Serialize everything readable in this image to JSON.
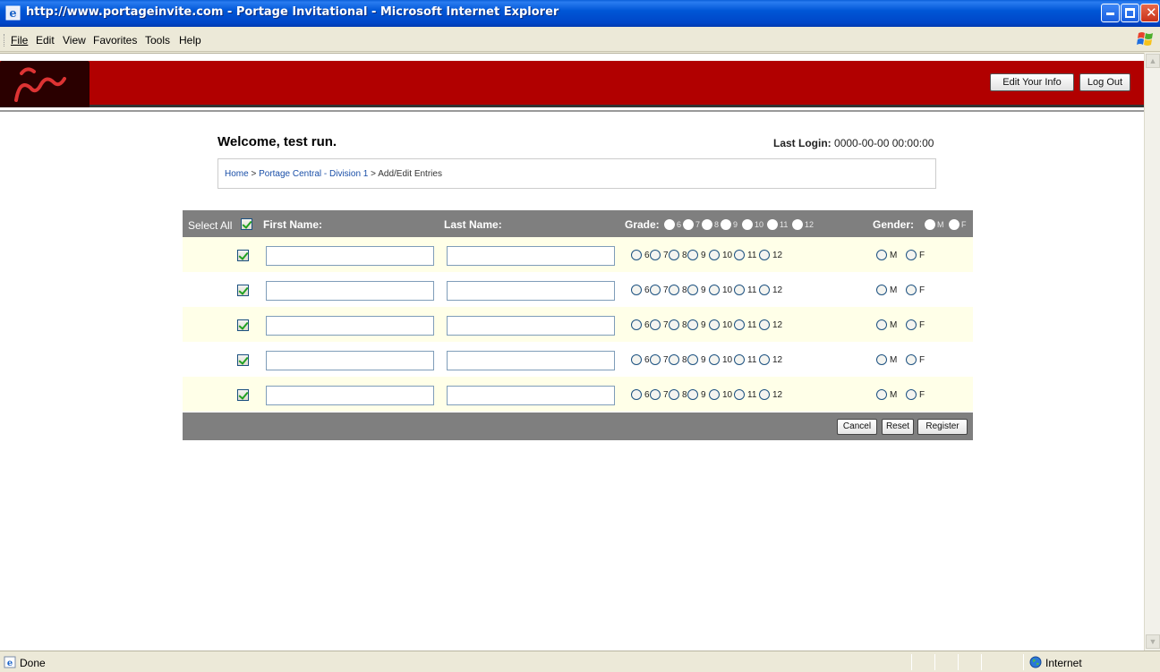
{
  "window": {
    "title": "http://www.portageinvite.com - Portage Invitational - Microsoft Internet Explorer"
  },
  "menu": [
    "File",
    "Edit",
    "View",
    "Favorites",
    "Tools",
    "Help"
  ],
  "header": {
    "edit_info_label": "Edit Your Info",
    "logout_label": "Log Out",
    "brand_color": "#b10000"
  },
  "welcome": {
    "text": "Welcome, test run.",
    "last_login_label": "Last Login:",
    "last_login_value": "0000-00-00 00:00:00"
  },
  "breadcrumb": {
    "home": "Home",
    "sep1": ">",
    "division": "Portage Central - Division 1",
    "sep2": ">",
    "current": "Add/Edit Entries"
  },
  "table": {
    "select_all_label": "Select All",
    "first_name_header": "First Name:",
    "last_name_header": "Last Name:",
    "grade_header": "Grade:",
    "gender_header": "Gender:",
    "grades": [
      "6",
      "7",
      "8",
      "9",
      "10",
      "11",
      "12"
    ],
    "genders": [
      "M",
      "F"
    ],
    "rows": [
      {
        "selected": true,
        "first_name": "",
        "last_name": ""
      },
      {
        "selected": true,
        "first_name": "",
        "last_name": ""
      },
      {
        "selected": true,
        "first_name": "",
        "last_name": ""
      },
      {
        "selected": true,
        "first_name": "",
        "last_name": ""
      },
      {
        "selected": true,
        "first_name": "",
        "last_name": ""
      }
    ],
    "cancel_label": "Cancel",
    "reset_label": "Reset",
    "register_label": "Register"
  },
  "status": {
    "text": "Done",
    "zone": "Internet"
  }
}
